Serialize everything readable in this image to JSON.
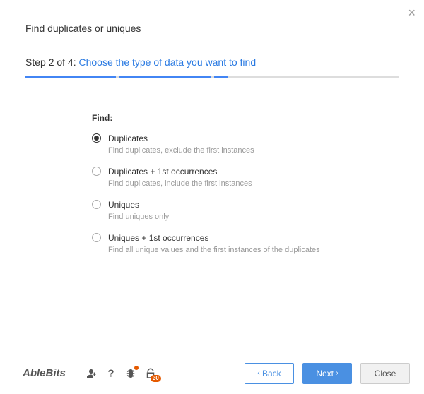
{
  "dialog": {
    "title": "Find duplicates or uniques",
    "close_glyph": "×"
  },
  "step": {
    "label": "Step 2 of 4: ",
    "desc": "Choose the type of data you want to find"
  },
  "find": {
    "heading": "Find:",
    "options": [
      {
        "label": "Duplicates",
        "hint": "Find duplicates, exclude the first instances",
        "selected": true
      },
      {
        "label": "Duplicates + 1st occurrences",
        "hint": "Find duplicates, include the first instances",
        "selected": false
      },
      {
        "label": "Uniques",
        "hint": "Find uniques only",
        "selected": false
      },
      {
        "label": "Uniques + 1st occurrences",
        "hint": "Find all unique values and the first instances of the duplicates",
        "selected": false
      }
    ]
  },
  "footer": {
    "brand": "AbleBits",
    "lock_badge": "30",
    "buttons": {
      "back": "Back",
      "next": "Next",
      "close": "Close"
    },
    "chev_left": "‹",
    "chev_right": "›"
  }
}
